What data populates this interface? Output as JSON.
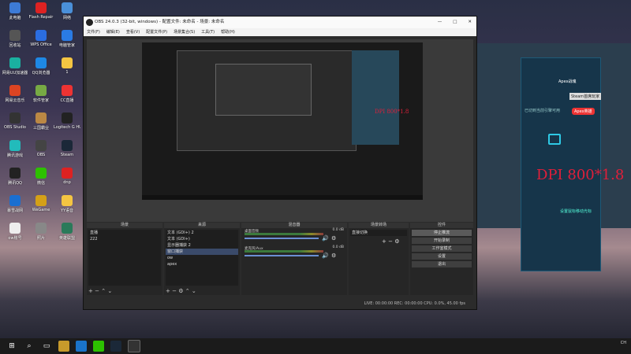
{
  "desktop_icons": [
    {
      "label": "此电脑",
      "color": "#3d7bd6"
    },
    {
      "label": "Flash Repair",
      "color": "#d22"
    },
    {
      "label": "网络",
      "color": "#4a90d9"
    },
    {
      "label": "回收站",
      "color": "#555"
    },
    {
      "label": "WPS Office",
      "color": "#2b6de0"
    },
    {
      "label": "电脑管家",
      "color": "#2a7be4"
    },
    {
      "label": "网易UU加速器",
      "color": "#1ab0a0"
    },
    {
      "label": "QQ浏览器",
      "color": "#1e88e5"
    },
    {
      "label": "1",
      "color": "#f4c542"
    },
    {
      "label": "网易云音乐",
      "color": "#d42"
    },
    {
      "label": "软件管家",
      "color": "#7a4"
    },
    {
      "label": "CC直播",
      "color": "#e33"
    },
    {
      "label": "OBS Studio",
      "color": "#333"
    },
    {
      "label": "三国霸业",
      "color": "#b84"
    },
    {
      "label": "Logitech G HUB",
      "color": "#222"
    },
    {
      "label": "腾讯游戏",
      "color": "#2bb"
    },
    {
      "label": "OBS",
      "color": "#444"
    },
    {
      "label": "Steam",
      "color": "#1b2838"
    },
    {
      "label": "腾讯QQ",
      "color": "#222"
    },
    {
      "label": "微信",
      "color": "#2dc100"
    },
    {
      "label": "dnp",
      "color": "#d22"
    },
    {
      "label": "暴雪战网",
      "color": "#1a6fd1"
    },
    {
      "label": "WeGame",
      "color": "#d4a017"
    },
    {
      "label": "YY语音",
      "color": "#f4c542"
    },
    {
      "label": "ow账号",
      "color": "#eee"
    },
    {
      "label": "照片",
      "color": "#888"
    },
    {
      "label": "英雄联盟",
      "color": "#2a7a5a"
    }
  ],
  "apex_app": {
    "title": "Apex战魂",
    "menu_label": "Steam首席玩家",
    "badge": "Apex英雄",
    "hint": "已切到当前引擎可用",
    "dpi": "DPI 800*1.8",
    "footer": "设置鼠标移动光标"
  },
  "obs": {
    "title": "OBS 24.0.3 (32-bit, windows) - 配置文件: 未命名 - 场景: 未命名",
    "window_buttons": [
      "—",
      "□",
      "✕"
    ],
    "menu": [
      "文件(F)",
      "编辑(E)",
      "查看(V)",
      "配置文件(P)",
      "场景集合(S)",
      "工具(T)",
      "帮助(H)"
    ],
    "scenes": {
      "header": "场景",
      "items": [
        "直播",
        "222"
      ],
      "selected": 0
    },
    "sources": {
      "header": "来源",
      "items": [
        "文本 (GDI+) 2",
        "文本 (GDI+)",
        "显示器捕获 2",
        "窗口捕获",
        "ow",
        "apex"
      ],
      "selected": 3
    },
    "mixer": {
      "header": "混音器",
      "tracks": [
        {
          "name": "桌面音频",
          "db": "0.0 dB"
        },
        {
          "name": "麦克风/Aux",
          "db": "0.0 dB"
        }
      ]
    },
    "transitions": {
      "header": "场景转场",
      "value": "直接切换"
    },
    "controls": {
      "header": "控件",
      "buttons": [
        "停止推流",
        "开始录制",
        "工作室模式",
        "设置",
        "退出"
      ]
    },
    "status": "LIVE: 00:00:00    REC: 00:00:00    CPU: 0.0%, 45.00 fps"
  },
  "taskbar": {
    "time": "",
    "date": "",
    "lang": "CH"
  }
}
